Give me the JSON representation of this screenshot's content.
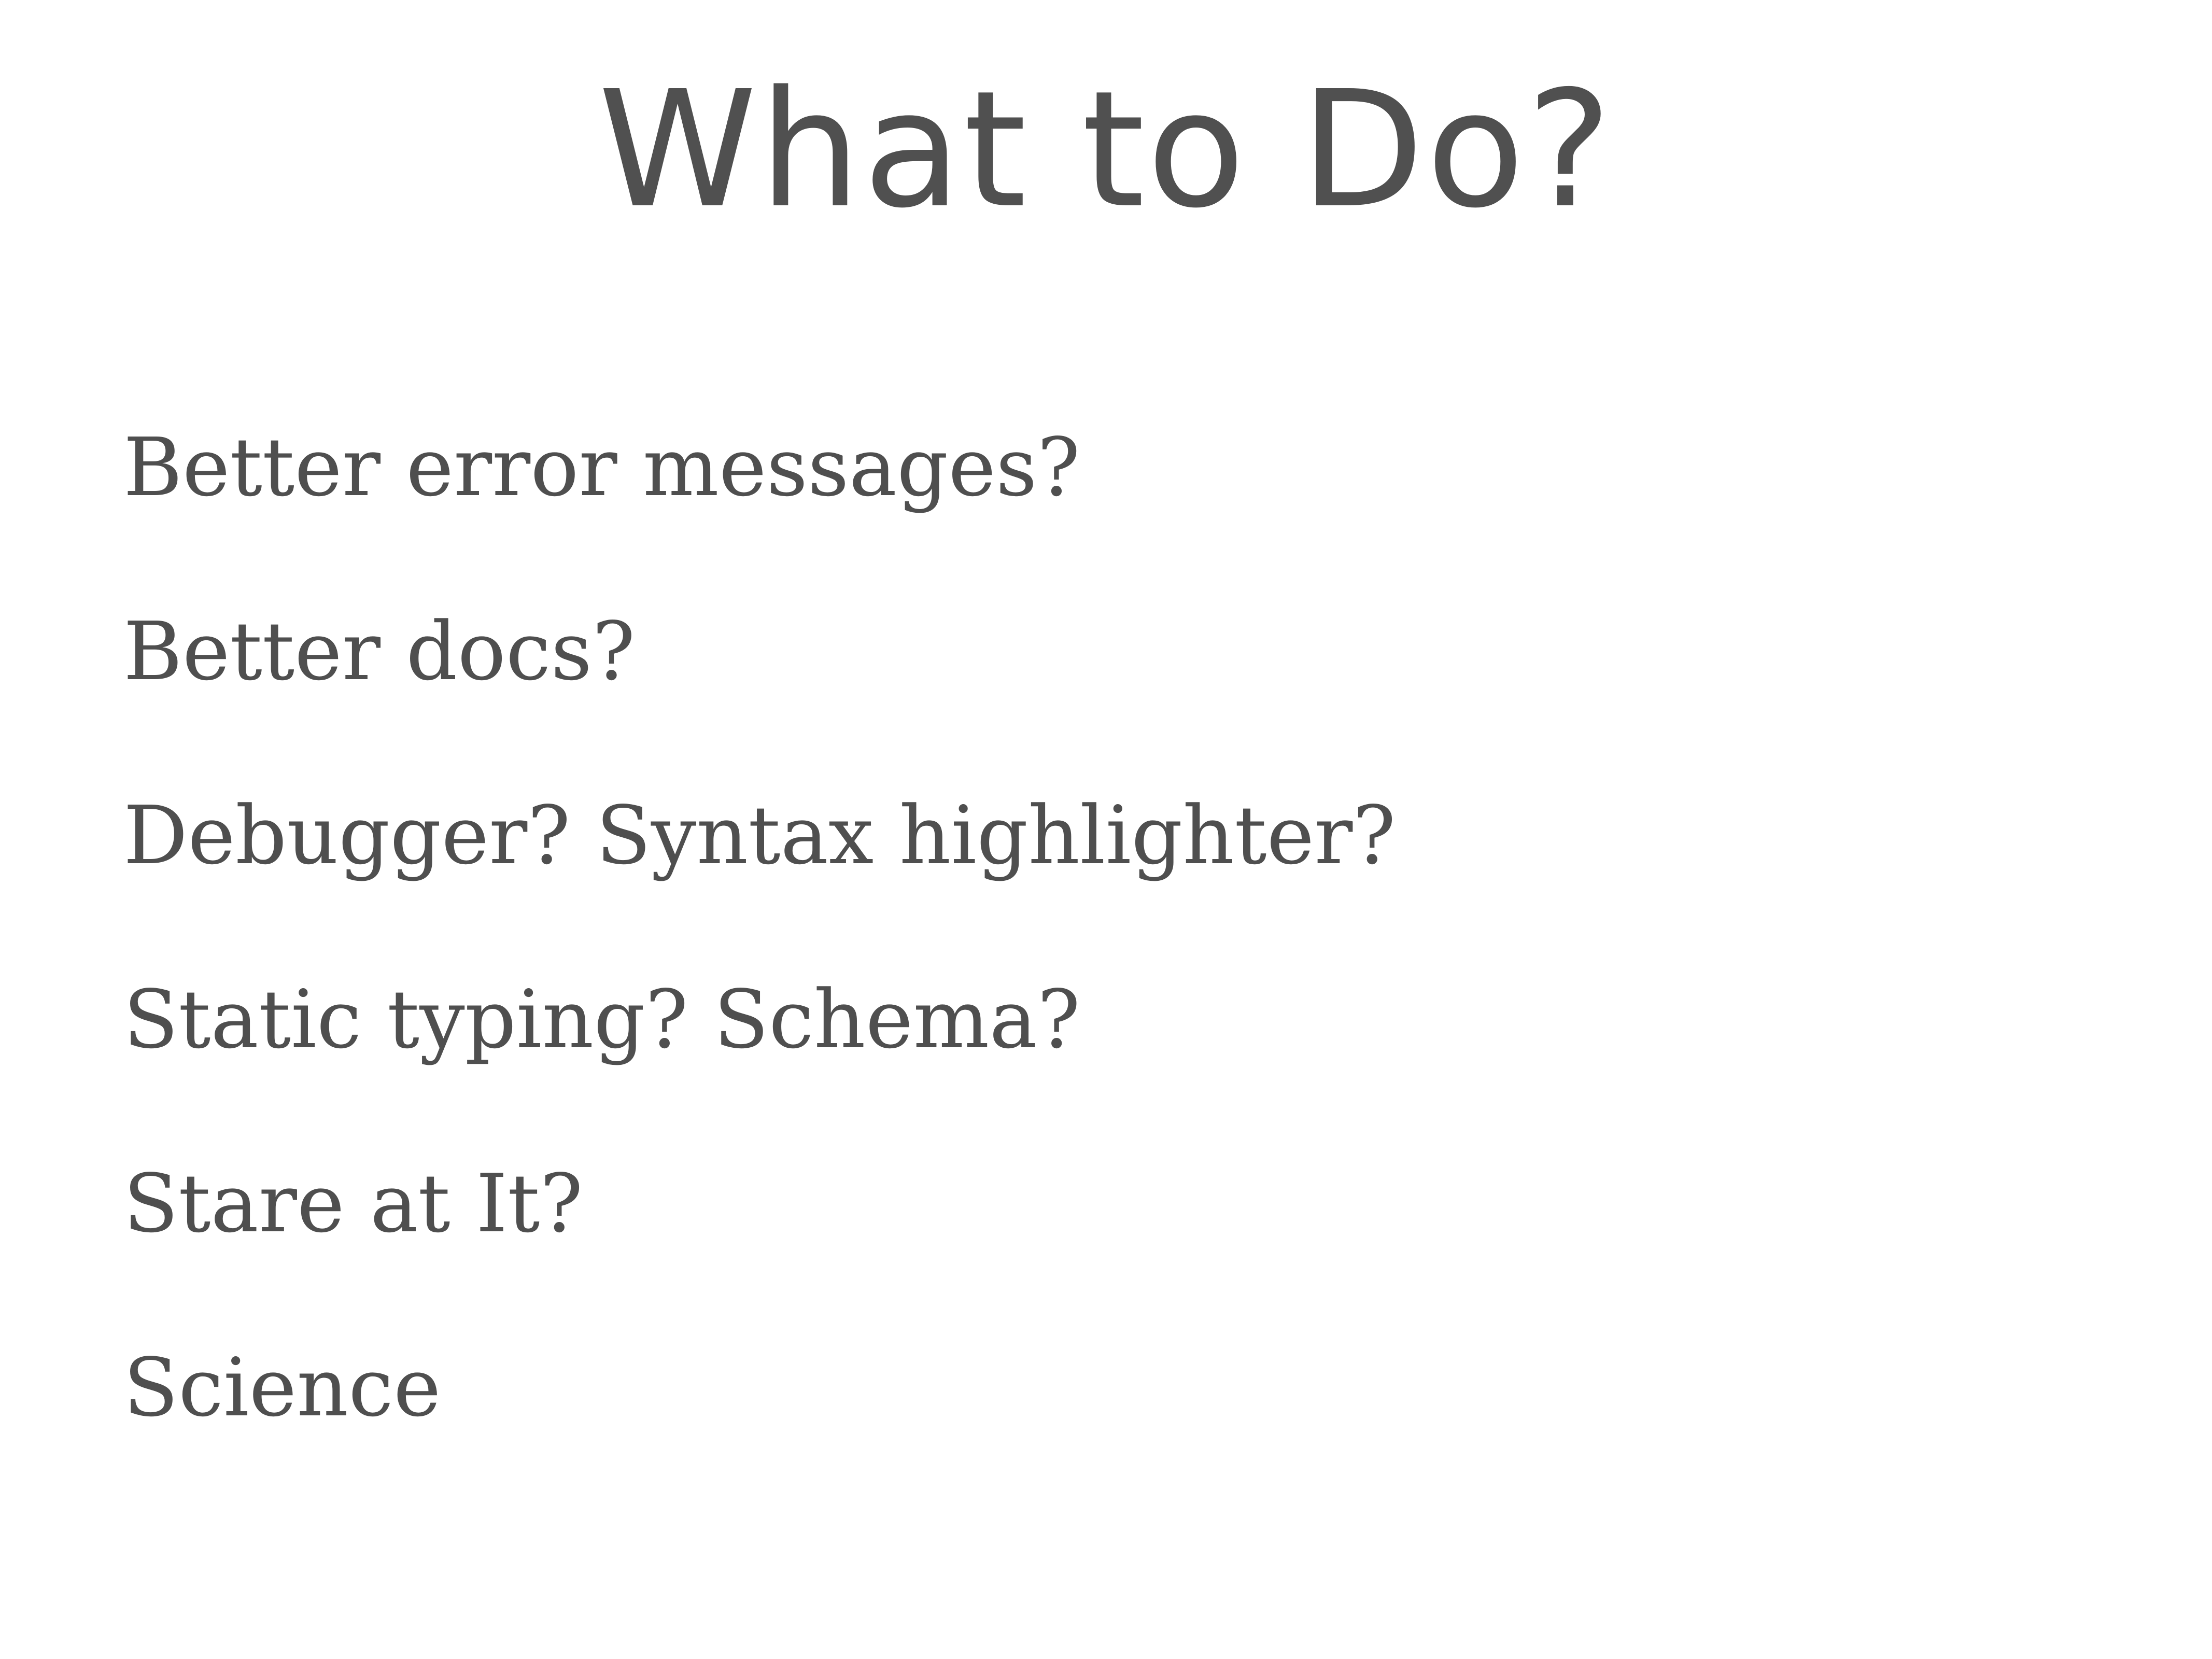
{
  "slide": {
    "title": "What to Do?",
    "items": [
      "Better error messages?",
      "Better docs?",
      "Debugger? Syntax highlighter?",
      "Static typing? Schema?",
      "Stare at It?",
      "Science"
    ],
    "colors": {
      "background": "#ffffff",
      "text": "#505050"
    }
  }
}
